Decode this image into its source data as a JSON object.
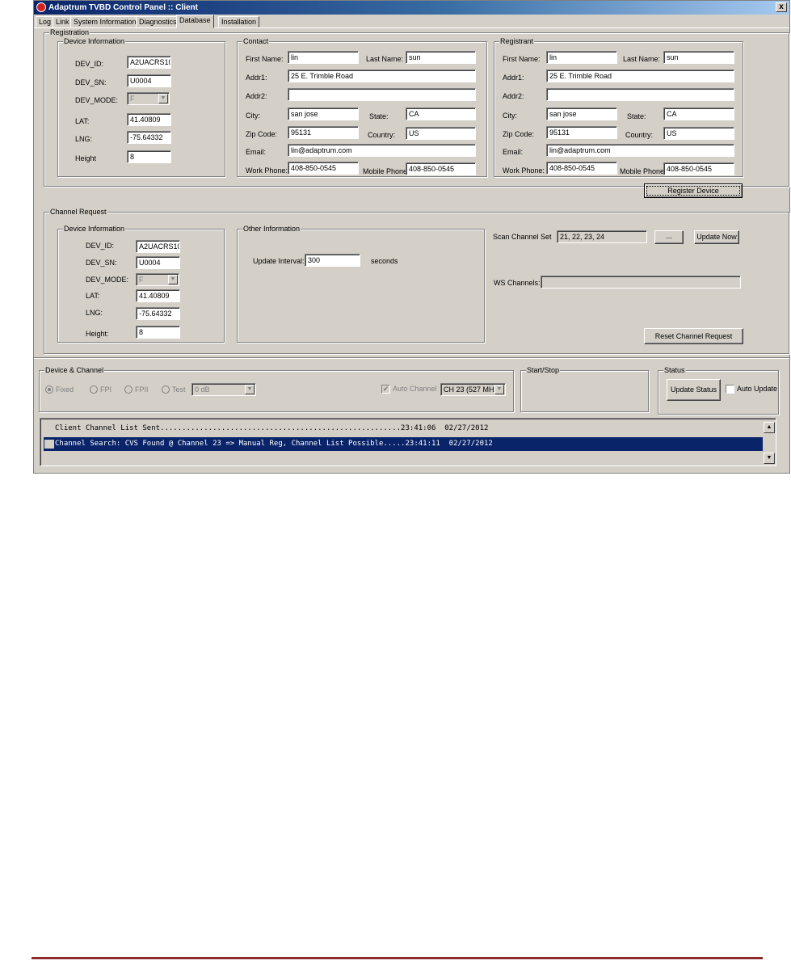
{
  "window": {
    "title": "Adaptrum TVBD Control Panel :: Client",
    "close": "x"
  },
  "tabs": [
    "Log",
    "Link",
    "System Information",
    "Diagnostics",
    "Database",
    "Installation"
  ],
  "active_tab": "Database",
  "registration": {
    "legend": "Registration",
    "device": {
      "legend": "Device Information",
      "dev_id_label": "DEV_ID:",
      "dev_id": "A2UACRS10",
      "dev_sn_label": "DEV_SN:",
      "dev_sn": "U0004",
      "dev_mode_label": "DEV_MODE:",
      "dev_mode": "F",
      "lat_label": "LAT:",
      "lat": "41.40809",
      "lng_label": "LNG:",
      "lng": "-75.64332",
      "height_label": "Height",
      "height": "8"
    },
    "contact": {
      "legend": "Contact",
      "first_name_label": "First Name:",
      "first_name": "lin",
      "last_name_label": "Last Name:",
      "last_name": "sun",
      "addr1_label": "Addr1:",
      "addr1": "25 E. Trimble Road",
      "addr2_label": "Addr2:",
      "addr2": "",
      "city_label": "City:",
      "city": "san jose",
      "state_label": "State:",
      "state": "CA",
      "zip_label": "Zip Code:",
      "zip": "95131",
      "country_label": "Country:",
      "country": "US",
      "email_label": "Email:",
      "email": "lin@adaptrum.com",
      "work_phone_label": "Work Phone:",
      "work_phone": "408-850-0545",
      "mobile_phone_label": "Mobile Phone:",
      "mobile_phone": "408-850-0545"
    },
    "registrant": {
      "legend": "Registrant",
      "first_name_label": "First Name:",
      "first_name": "lin",
      "last_name_label": "Last Name:",
      "last_name": "sun",
      "addr1_label": "Addr1:",
      "addr1": "25 E. Trimble Road",
      "addr2_label": "Addr2:",
      "addr2": "",
      "city_label": "City:",
      "city": "san jose",
      "state_label": "State:",
      "state": "CA",
      "zip_label": "Zip Code:",
      "zip": "95131",
      "country_label": "Country:",
      "country": "US",
      "email_label": "Email:",
      "email": "lin@adaptrum.com",
      "work_phone_label": "Work Phone:",
      "work_phone": "408-850-0545",
      "mobile_phone_label": "Mobile Phone:",
      "mobile_phone": "408-850-0545"
    },
    "register_button": "Register Device"
  },
  "channel_request": {
    "legend": "Channel Request",
    "device": {
      "legend": "Device Information",
      "dev_id_label": "DEV_ID:",
      "dev_id": "A2UACRS10",
      "dev_sn_label": "DEV_SN:",
      "dev_sn": "U0004",
      "dev_mode_label": "DEV_MODE:",
      "dev_mode": "F",
      "lat_label": "LAT:",
      "lat": "41.40809",
      "lng_label": "LNG:",
      "lng": "-75.64332",
      "height_label": "Height:",
      "height": "8"
    },
    "other": {
      "legend": "Other Information",
      "update_interval_label": "Update Interval:",
      "update_interval": "300",
      "unit": "seconds"
    },
    "scan_channel_set_label": "Scan Channel Set",
    "scan_channel_set": "21, 22, 23, 24",
    "browse_button": "...",
    "update_now_button": "Update Now",
    "ws_channels_label": "WS Channels:",
    "ws_channels": "",
    "reset_button": "Reset Channel Request"
  },
  "device_channel": {
    "legend": "Device & Channel",
    "radios": [
      "Fixed",
      "FPI",
      "FPII",
      "Test"
    ],
    "selected_radio": "Fixed",
    "power": "0 dB",
    "auto_channel_label": "Auto Channel",
    "auto_channel_checked": true,
    "channel": "CH 23 (527 MHz)"
  },
  "start_stop": {
    "legend": "Start/Stop"
  },
  "status": {
    "legend": "Status",
    "update_button": "Update Status",
    "auto_update_label": "Auto Update",
    "auto_update_checked": false
  },
  "log": [
    {
      "text": "Client Channel List Sent.......................................................23:41:06  02/27/2012",
      "selected": false
    },
    {
      "text": "Channel Search: CVS Found @ Channel 23 => Manual Reg, Channel List Possible.....23:41:11  02/27/2012",
      "selected": true
    }
  ],
  "colors": {
    "selection": "#0a246a",
    "face": "#d4d0c8",
    "footer_rule": "#8b2b2b"
  }
}
